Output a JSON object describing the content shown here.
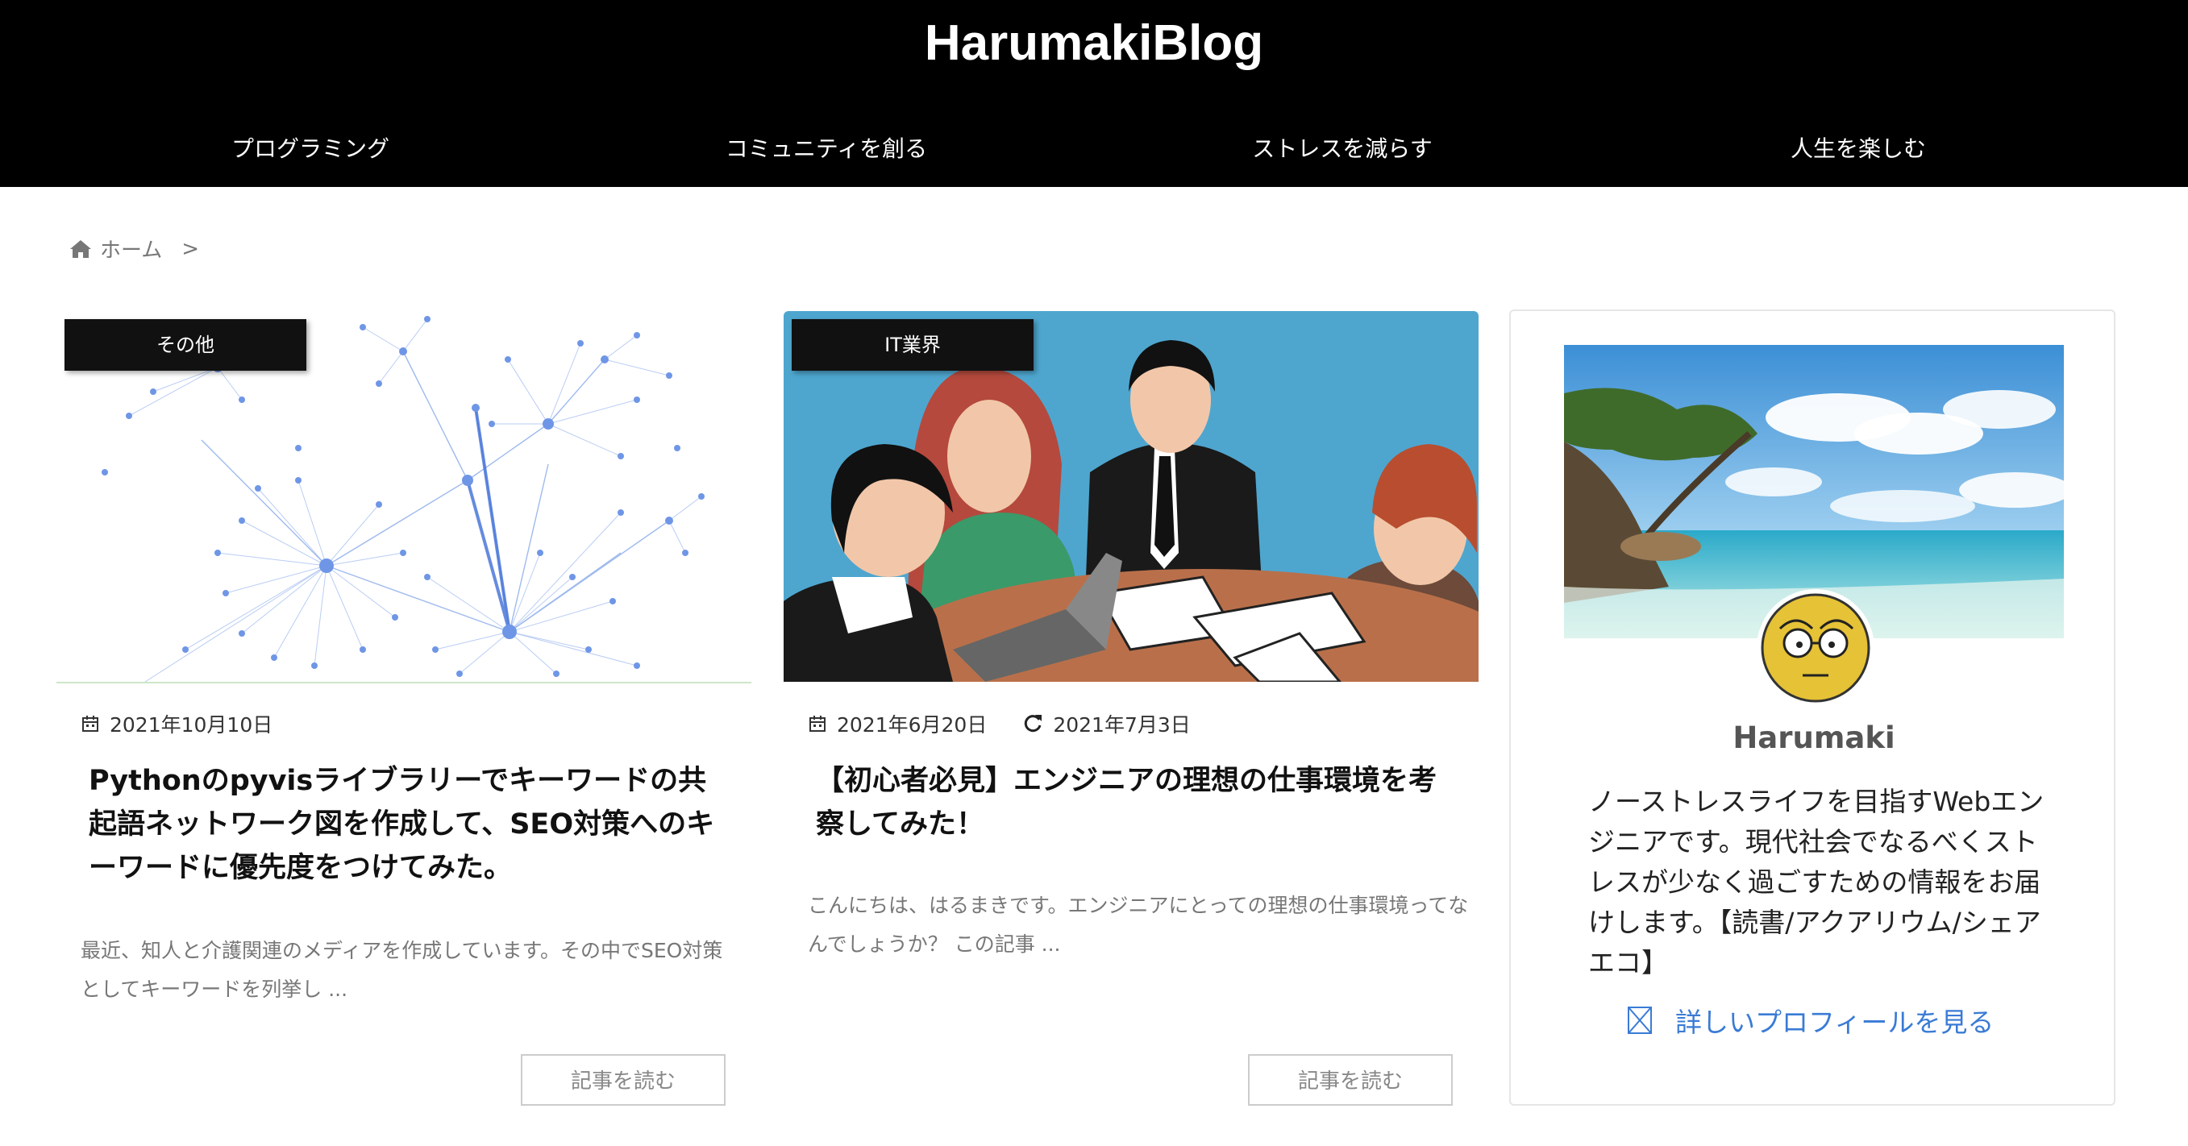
{
  "header": {
    "site_title": "HarumakiBlog",
    "nav": [
      "プログラミング",
      "コミュニティを創る",
      "ストレスを減らす",
      "人生を楽しむ"
    ]
  },
  "breadcrumb": {
    "home": "ホーム",
    "separator": ">",
    "icon": "home-icon"
  },
  "cards": [
    {
      "category": "その他",
      "date": "2021年10月10日",
      "title": "Pythonのpyvisライブラリーでキーワードの共起語ネットワーク図を作成して、SEO対策へのキーワードに優先度をつけてみた。",
      "excerpt": "最近、知人と介護関連のメディアを作成しています。その中でSEO対策としてキーワードを列挙し ...",
      "button": "記事を読む"
    },
    {
      "category": "IT業界",
      "date": "2021年6月20日",
      "updated": "2021年7月3日",
      "title": "【初心者必見】エンジニアの理想の仕事環境を考察してみた！",
      "excerpt": "こんにちは、はるまきです。エンジニアにとっての理想の仕事環境ってなんでしょうか？ この記事 ...",
      "button": "記事を読む"
    }
  ],
  "profile": {
    "name": "Harumaki",
    "description": "ノーストレスライフを目指すWebエンジニアです。現代社会でなるべくストレスが少なく過ごすための情報をお届けします。【読書/アクアリウム/シェアエコ】",
    "link": "詳しいプロフィールを見る"
  },
  "colors": {
    "header_bg": "#000000",
    "link": "#3a7bd5",
    "category_bg": "#111111"
  }
}
